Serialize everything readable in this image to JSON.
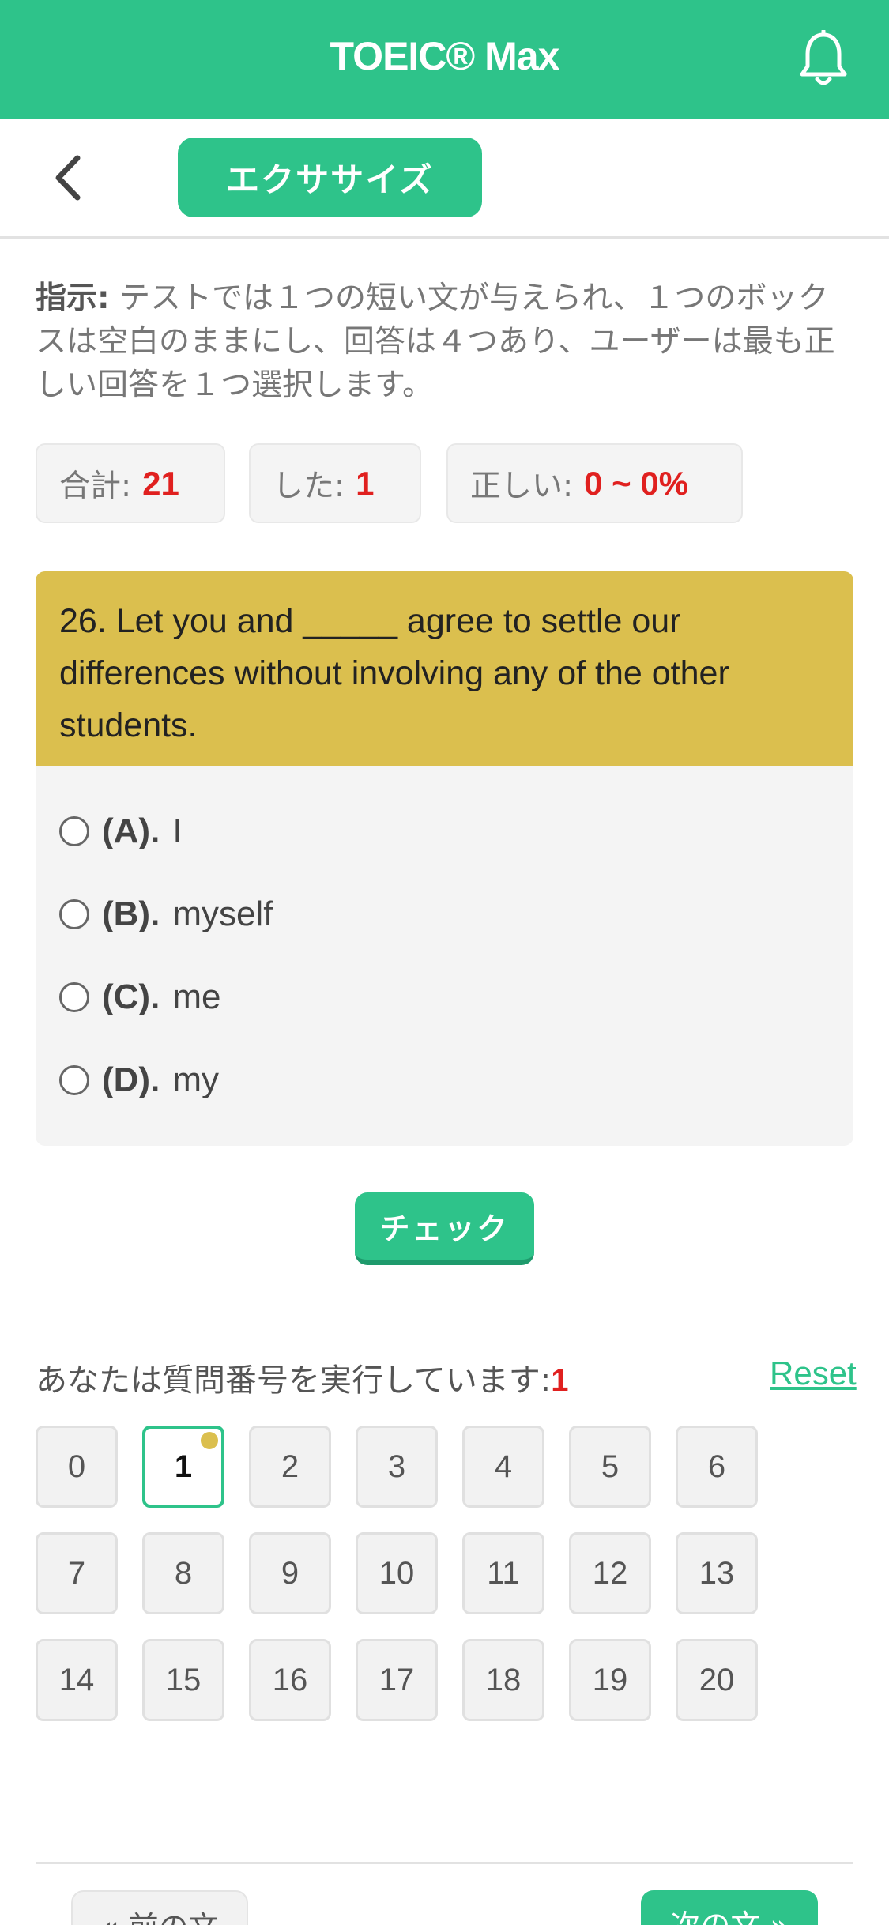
{
  "header": {
    "title": "TOEIC® Max",
    "bell_icon": "bell-icon"
  },
  "nav": {
    "back_icon": "chevron-left-icon",
    "exercise_label": "エクササイズ"
  },
  "instructions": {
    "label": "指示:",
    "text": " テストでは１つの短い文が与えられ、１つのボックスは空白のままにし、回答は４つあり、ユーザーは最も正しい回答を１つ選択します。"
  },
  "stats": {
    "total_label": "合計:",
    "total_value": "21",
    "done_label": "した:",
    "done_value": "1",
    "correct_label": "正しい:",
    "correct_value": "0 ~ 0%"
  },
  "question": {
    "text": "26. Let you and _____ agree to settle our differences without involving any of the other students.",
    "options": [
      {
        "letter": "(A).",
        "text": "I"
      },
      {
        "letter": "(B).",
        "text": "myself"
      },
      {
        "letter": "(C).",
        "text": "me"
      },
      {
        "letter": "(D).",
        "text": "my"
      }
    ]
  },
  "check_label": "チェック",
  "progress": {
    "label": "あなたは質問番号を実行しています:",
    "current": "1",
    "reset_label": "Reset"
  },
  "question_numbers": [
    "0",
    "1",
    "2",
    "3",
    "4",
    "5",
    "6",
    "7",
    "8",
    "9",
    "10",
    "11",
    "12",
    "13",
    "14",
    "15",
    "16",
    "17",
    "18",
    "19",
    "20"
  ],
  "active_question": "1",
  "footer": {
    "prev_label": "« 前の文",
    "next_label": "次の文 »"
  },
  "colors": {
    "primary": "#2ec38a",
    "question_bg": "#dbbf4e",
    "highlight": "#e0201f"
  }
}
